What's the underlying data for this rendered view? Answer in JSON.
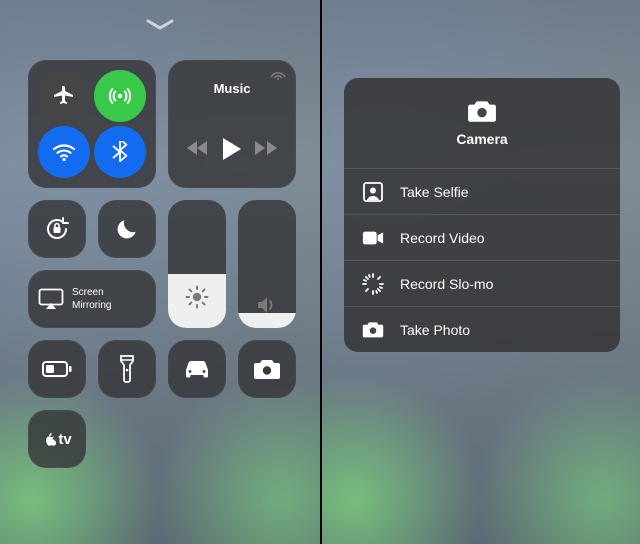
{
  "left": {
    "music_label": "Music",
    "screen_mirroring_label": "Screen\nMirroring",
    "appletv_label": "tv",
    "brightness_pct": 42,
    "volume_pct": 12
  },
  "right": {
    "menu_title": "Camera",
    "items": {
      "0": {
        "label": "Take Selfie"
      },
      "1": {
        "label": "Record Video"
      },
      "2": {
        "label": "Record Slo-mo"
      },
      "3": {
        "label": "Take Photo"
      }
    }
  }
}
